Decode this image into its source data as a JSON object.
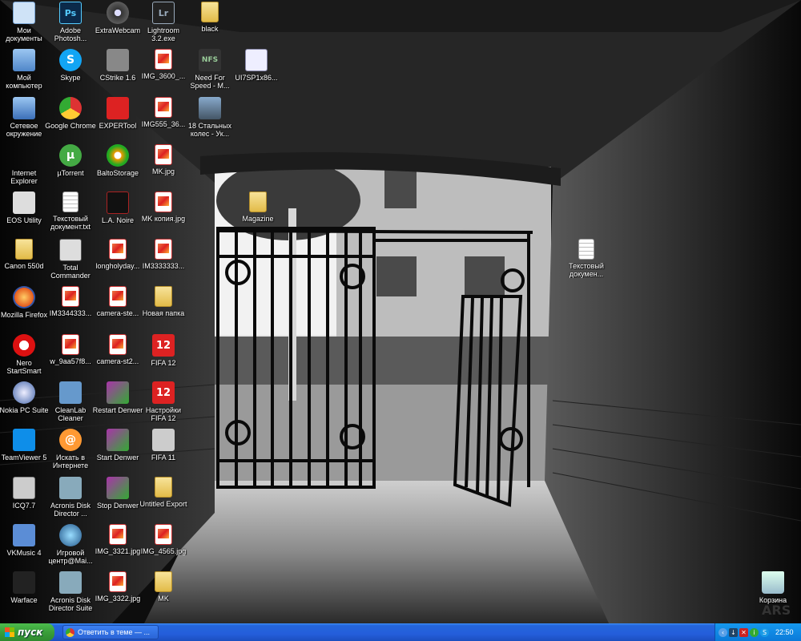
{
  "desktop": {
    "watermark": "ARS",
    "icons": [
      {
        "label": "Мои документы",
        "glyph": "docs-icon"
      },
      {
        "label": "Мой компьютер",
        "glyph": "computer-icon"
      },
      {
        "label": "Сетевое окружение",
        "glyph": "network-icon"
      },
      {
        "label": "Internet Explorer",
        "glyph": "ie-icon"
      },
      {
        "label": "EOS Utility",
        "glyph": "eos-icon"
      },
      {
        "label": "Canon 550d",
        "glyph": "folder-icon"
      },
      {
        "label": "Mozilla Firefox",
        "glyph": "firefox-icon"
      },
      {
        "label": "Nero StartSmart",
        "glyph": "nero-icon"
      },
      {
        "label": "Nokia PC Suite",
        "glyph": "nokia-icon"
      },
      {
        "label": "TeamViewer 5",
        "glyph": "teamviewer-icon"
      },
      {
        "label": "ICQ7.7",
        "glyph": "icq-icon"
      },
      {
        "label": "VKMusic 4",
        "glyph": "vkmusic-icon"
      },
      {
        "label": "Warface",
        "glyph": "warface-icon"
      },
      {
        "label": "Adobe Photosh...",
        "glyph": "photoshop-icon",
        "glyph_text": "Ps"
      },
      {
        "label": "Skype",
        "glyph": "skype-icon",
        "glyph_text": "S"
      },
      {
        "label": "Google Chrome",
        "glyph": "chrome-icon"
      },
      {
        "label": "µTorrent",
        "glyph": "utorrent-icon",
        "glyph_text": "µ"
      },
      {
        "label": "Текстовый документ.txt",
        "glyph": "doc-icon"
      },
      {
        "label": "Total Commander",
        "glyph": "totalcmd-icon"
      },
      {
        "label": "IM3344333...",
        "glyph": "jpg-icon"
      },
      {
        "label": "w_9aa57f8...",
        "glyph": "jpg-icon"
      },
      {
        "label": "CleanLab Cleaner",
        "glyph": "cleanlab-icon"
      },
      {
        "label": "Искать в Интернете",
        "glyph": "search-web-icon",
        "glyph_text": "@"
      },
      {
        "label": "Acronis Disk Director ...",
        "glyph": "acronis-icon"
      },
      {
        "label": "Игровой центр@Mai...",
        "glyph": "gamecenter-icon"
      },
      {
        "label": "Acronis Disk Director Suite",
        "glyph": "acronis-icon"
      },
      {
        "label": "ExtraWebcam",
        "glyph": "webcam-icon"
      },
      {
        "label": "CStrike 1.6",
        "glyph": "cstrike-icon"
      },
      {
        "label": "EXPERTool",
        "glyph": "expertool-icon"
      },
      {
        "label": "BaltoStorage",
        "glyph": "balto-icon"
      },
      {
        "label": "L.A. Noire",
        "glyph": "lanoire-icon"
      },
      {
        "label": "longholyday...",
        "glyph": "jpg-icon"
      },
      {
        "label": "camera-ste...",
        "glyph": "jpg-icon"
      },
      {
        "label": "camera-st2...",
        "glyph": "jpg-icon"
      },
      {
        "label": "Restart Denwer",
        "glyph": "denwer-icon"
      },
      {
        "label": "Start Denwer",
        "glyph": "denwer-icon"
      },
      {
        "label": "Stop Denwer",
        "glyph": "denwer-icon"
      },
      {
        "label": "IMG_3321.jpg",
        "glyph": "jpg-icon"
      },
      {
        "label": "IMG_3322.jpg",
        "glyph": "jpg-icon"
      },
      {
        "label": "Lightroom 3.2.exe",
        "glyph": "lightroom-icon",
        "glyph_text": "Lr"
      },
      {
        "label": "IMG_3600_...",
        "glyph": "jpg-icon"
      },
      {
        "label": "IMG555_36...",
        "glyph": "jpg-icon"
      },
      {
        "label": "MK.jpg",
        "glyph": "jpg-icon"
      },
      {
        "label": "MK копия.jpg",
        "glyph": "jpg-icon"
      },
      {
        "label": "IM3333333...",
        "glyph": "jpg-icon"
      },
      {
        "label": "Новая папка",
        "glyph": "folder-icon"
      },
      {
        "label": "FIFA 12",
        "glyph": "fifa12-icon",
        "glyph_text": "12"
      },
      {
        "label": "Настройки FIFA 12",
        "glyph": "fifa12-icon",
        "glyph_text": "12"
      },
      {
        "label": "FIFA 11",
        "glyph": "fifa11-icon"
      },
      {
        "label": "Untitled Export",
        "glyph": "folder-icon"
      },
      {
        "label": "IMG_4565.jpg",
        "glyph": "jpg-icon"
      },
      {
        "label": "MK",
        "glyph": "folder-icon"
      },
      {
        "label": "black",
        "glyph": "folder-icon"
      },
      {
        "label": "Need For Speed - M...",
        "glyph": "nfs-icon",
        "glyph_text": "NFS"
      },
      {
        "label": "18 Стальных колес - Ук...",
        "glyph": "truck-icon"
      },
      {
        "label": "UI7SP1x86...",
        "glyph": "installer-icon"
      },
      {
        "label": "Magazine",
        "glyph": "folder-icon"
      },
      {
        "label": "Текстовый докумен...",
        "glyph": "doc-icon"
      },
      {
        "label": "Корзина",
        "glyph": "recycle-bin-icon"
      }
    ]
  },
  "taskbar": {
    "start_label": "пуск",
    "task_label": "Ответить в теме — ...",
    "clock": "22:50"
  }
}
